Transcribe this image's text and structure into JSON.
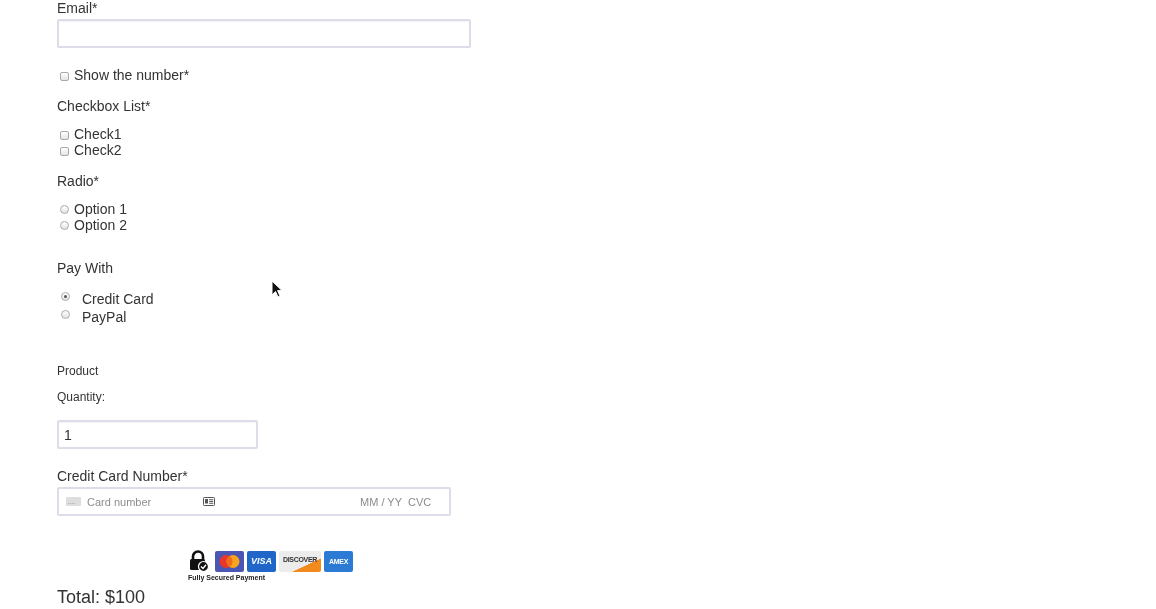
{
  "email": {
    "label": "Email*"
  },
  "show_number": {
    "label": "Show the number*",
    "checked": false
  },
  "checkbox_list": {
    "label": "Checkbox List*",
    "options": [
      {
        "label": "Check1",
        "checked": false
      },
      {
        "label": "Check2",
        "checked": false
      }
    ]
  },
  "radio": {
    "label": "Radio*",
    "options": [
      {
        "label": "Option 1",
        "selected": false
      },
      {
        "label": "Option 2",
        "selected": false
      }
    ]
  },
  "pay_with": {
    "label": "Pay With",
    "options": [
      {
        "label": "Credit Card",
        "selected": true
      },
      {
        "label": "PayPal",
        "selected": false
      }
    ]
  },
  "product": {
    "label": "Product",
    "quantity_label": "Quantity:",
    "quantity": "1"
  },
  "card": {
    "label": "Credit Card Number*",
    "number_placeholder": "Card number",
    "expiry_placeholder": "MM / YY",
    "cvc_placeholder": "CVC"
  },
  "secure_payment": {
    "caption": "Fully Secured Payment",
    "cards": [
      {
        "kind": "mastercard"
      },
      {
        "kind": "visa",
        "label": "VISA"
      },
      {
        "kind": "discover",
        "label": "DISCOVER"
      },
      {
        "kind": "amex",
        "label": "AMEX"
      }
    ]
  },
  "total": "Total: $100"
}
